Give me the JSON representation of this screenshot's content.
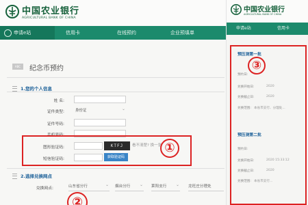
{
  "left": {
    "brand": {
      "cn": "中国农业银行",
      "en": "AGRICULTURAL BANK OF CHINA"
    },
    "nav": [
      {
        "label": "申请e站"
      },
      {
        "label": "信用卡"
      },
      {
        "label": "在线预约"
      },
      {
        "label": "企业预填单"
      }
    ],
    "heading_badge": "ABC",
    "heading": "纪念币预约",
    "section1": "1.您的个人信息",
    "fields": [
      {
        "label": "姓 名:"
      },
      {
        "label": "证件类型:",
        "value": "身份证"
      },
      {
        "label": "证件号码:"
      },
      {
        "label": "手机号码:"
      },
      {
        "label": "图形验证码:"
      },
      {
        "label": "短信验证码:"
      }
    ],
    "captcha_text": "KTFJ",
    "hint": "看不清楚? 换一张",
    "sms_button": "获取验证码",
    "section2": "2.选择兑换网点",
    "outlet_label": "兑换网点:",
    "outlet_selects": [
      "山东省分行",
      "烟台分行",
      "莱阳支行",
      "龙旺庄分理处"
    ]
  },
  "right": {
    "brand": {
      "cn": "中国农业银行",
      "en": "AGRICULTURAL BANK OF CHINA"
    },
    "nav": [
      {
        "label": "申请e站"
      },
      {
        "label": "信用卡"
      }
    ],
    "batch1": "预压测第一批",
    "batch1_lines": [
      {
        "text": "预约日:",
        "value": ""
      },
      {
        "text": "兑换开始日:",
        "value": "2020"
      },
      {
        "text": "兑换截止日:",
        "value": "2020"
      },
      {
        "text": "兑换范围:",
        "value": "本省市支行、分理处..."
      }
    ],
    "batch2": "预压测第二批",
    "batch2_lines": [
      {
        "text": "预约日:",
        "value": ""
      },
      {
        "text": "兑换开始日:",
        "value": "2020 15:33:12"
      },
      {
        "text": "兑换截止日:",
        "value": "2020"
      },
      {
        "text": "兑换范围:",
        "value": "本省市支行..."
      }
    ]
  },
  "annotations": [
    "①",
    "②",
    "③"
  ],
  "colors": {
    "brand_green": "#16613b",
    "nav_green": "#1c8a6c",
    "link_blue": "#1a5f98",
    "annotation_red": "#dc2222",
    "button_blue": "#3a85c7"
  }
}
